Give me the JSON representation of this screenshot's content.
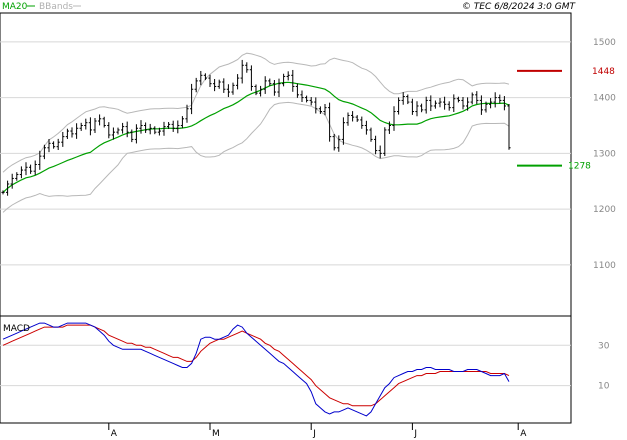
{
  "header": {
    "legend_ma": "MA20",
    "legend_bb": "BBands",
    "copyright": "© TEC 6/8/2024 3:0 GMT"
  },
  "colors": {
    "price": "#000000",
    "ma": "#00a000",
    "bands": "#b8b8b8",
    "grid": "#d8d8d8",
    "resistance": "#c00000",
    "support": "#00a000",
    "macd": "#0000cc",
    "signal": "#cc0000"
  },
  "chart_data": [
    {
      "type": "candlestick-ohlc",
      "title": "",
      "y_ticks": [
        1100,
        1200,
        1300,
        1400,
        1500
      ],
      "y_tick_labels": [
        "1100",
        "1200",
        "1300",
        "1400",
        "1500"
      ],
      "ylim": [
        1010,
        1550
      ],
      "x_month_labels": [
        {
          "label": "A",
          "index": 23
        },
        {
          "label": "M",
          "index": 45
        },
        {
          "label": "J",
          "index": 67
        },
        {
          "label": "J",
          "index": 89
        },
        {
          "label": "A",
          "index": 112
        }
      ],
      "levels": [
        {
          "name": "resistance",
          "value": 1448,
          "label": "1448"
        },
        {
          "name": "support",
          "value": 1278,
          "label": "1278"
        }
      ],
      "closes": [
        1230,
        1245,
        1255,
        1262,
        1270,
        1275,
        1268,
        1280,
        1295,
        1310,
        1318,
        1312,
        1320,
        1330,
        1340,
        1335,
        1345,
        1350,
        1355,
        1342,
        1358,
        1362,
        1350,
        1333,
        1338,
        1342,
        1348,
        1338,
        1325,
        1345,
        1350,
        1342,
        1345,
        1338,
        1340,
        1348,
        1352,
        1345,
        1350,
        1362,
        1380,
        1415,
        1430,
        1440,
        1435,
        1425,
        1420,
        1428,
        1415,
        1410,
        1422,
        1435,
        1458,
        1450,
        1420,
        1408,
        1415,
        1430,
        1425,
        1410,
        1425,
        1438,
        1440,
        1420,
        1405,
        1400,
        1395,
        1392,
        1380,
        1375,
        1382,
        1330,
        1310,
        1325,
        1355,
        1368,
        1365,
        1360,
        1350,
        1342,
        1325,
        1305,
        1300,
        1342,
        1350,
        1375,
        1395,
        1402,
        1392,
        1375,
        1385,
        1378,
        1395,
        1385,
        1390,
        1392,
        1388,
        1382,
        1398,
        1395,
        1385,
        1392,
        1405,
        1395,
        1378,
        1388,
        1392,
        1400,
        1395,
        1385,
        1310
      ]
    },
    {
      "type": "line",
      "title": "MACD",
      "y_ticks": [
        10,
        30
      ],
      "y_tick_labels": [
        "10",
        "30"
      ],
      "ylim": [
        -8,
        44
      ],
      "series": [
        {
          "name": "MACD",
          "values": [
            33,
            34,
            35,
            36,
            37,
            38,
            39,
            40,
            41,
            41,
            40,
            39,
            39,
            40,
            41,
            41,
            41,
            41,
            41,
            40,
            39,
            37,
            35,
            32,
            30,
            29,
            28,
            28,
            28,
            28,
            28,
            27,
            26,
            25,
            24,
            23,
            22,
            21,
            20,
            19,
            19,
            21,
            26,
            33,
            34,
            34,
            33,
            33,
            34,
            35,
            38,
            40,
            39,
            36,
            34,
            32,
            30,
            28,
            26,
            24,
            22,
            21,
            19,
            17,
            15,
            13,
            11,
            7,
            1,
            -1,
            -3,
            -4,
            -3,
            -3,
            -2,
            -1,
            -2,
            -3,
            -4,
            -5,
            -3,
            1,
            5,
            9,
            11,
            14,
            15,
            16,
            17,
            17,
            18,
            18,
            19,
            19,
            18,
            18,
            18,
            18,
            17,
            17,
            17,
            18,
            18,
            18,
            17,
            16,
            15,
            15,
            15,
            16,
            12
          ]
        },
        {
          "name": "Signal",
          "values": [
            30,
            31,
            32,
            33,
            34,
            35,
            36,
            37,
            38,
            39,
            39,
            39,
            39,
            39,
            40,
            40,
            40,
            40,
            40,
            40,
            39,
            38,
            37,
            35,
            34,
            33,
            32,
            31,
            31,
            30,
            30,
            29,
            29,
            28,
            27,
            26,
            25,
            24,
            24,
            23,
            22,
            22,
            24,
            27,
            29,
            31,
            32,
            33,
            33,
            34,
            35,
            36,
            37,
            36,
            35,
            34,
            33,
            31,
            30,
            28,
            27,
            25,
            23,
            21,
            19,
            17,
            15,
            13,
            10,
            8,
            6,
            4,
            3,
            2,
            1,
            1,
            0,
            0,
            0,
            0,
            0,
            1,
            3,
            5,
            7,
            9,
            11,
            12,
            13,
            14,
            15,
            15,
            16,
            16,
            16,
            17,
            17,
            17,
            17,
            17,
            17,
            17,
            17,
            17,
            17,
            17,
            16,
            16,
            16,
            16,
            15
          ]
        }
      ]
    }
  ]
}
